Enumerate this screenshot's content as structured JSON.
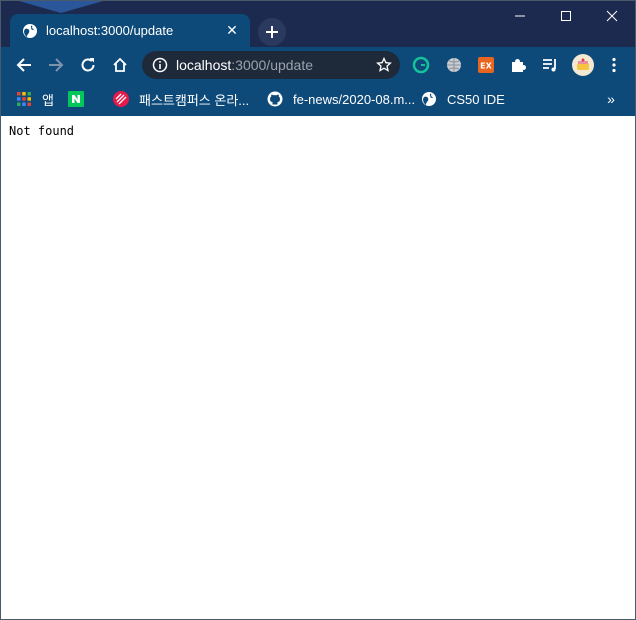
{
  "tab": {
    "title": "localhost:3000/update",
    "close_symbol": "✕"
  },
  "new_tab_icon": "plus-icon",
  "window_controls": [
    "minimize-icon",
    "maximize-icon",
    "close-icon"
  ],
  "toolbar": {
    "url_host": "localhost",
    "url_rest": ":3000/update",
    "buttons": [
      "back-icon",
      "forward-icon",
      "reload-icon",
      "home-icon"
    ],
    "extensions": [
      "grammarly-icon",
      "translate-globe-icon",
      "ex-extension-icon",
      "puzzle-extensions-icon",
      "media-playlist-icon",
      "profile-avatar-icon",
      "more-menu-icon"
    ]
  },
  "bookmarks": {
    "items": [
      {
        "label": "앱",
        "icon": "apps-grid-icon"
      },
      {
        "label": "",
        "icon": "naver-n-icon"
      },
      {
        "label": "패스트캠퍼스 온라...",
        "icon": "fastcampus-icon"
      },
      {
        "label": "fe-news/2020-08.m...",
        "icon": "github-icon"
      },
      {
        "label": "CS50 IDE",
        "icon": "globe-icon"
      }
    ],
    "more_symbol": "»"
  },
  "page": {
    "message": "Not found"
  },
  "colors": {
    "tabstrip": "#1b2a4e",
    "toolbar": "#0d4a7a",
    "omnibox": "#1e2a3a",
    "page_bg": "#ffffff"
  }
}
